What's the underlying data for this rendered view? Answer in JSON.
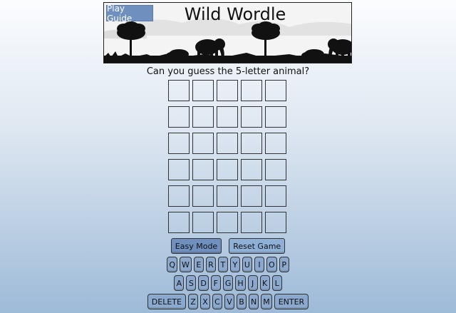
{
  "header": {
    "title": "Wild Wordle",
    "guide_label": "Play Guide"
  },
  "prompt": "Can you guess the 5-letter animal?",
  "board": {
    "rows": 6,
    "cols": 5
  },
  "controls": {
    "easy_label": "Easy Mode",
    "reset_label": "Reset Game"
  },
  "keyboard": {
    "row1": [
      "Q",
      "W",
      "E",
      "R",
      "T",
      "Y",
      "U",
      "I",
      "O",
      "P"
    ],
    "row2": [
      "A",
      "S",
      "D",
      "F",
      "G",
      "H",
      "J",
      "K",
      "L"
    ],
    "row3": [
      "DELETE",
      "Z",
      "X",
      "C",
      "V",
      "B",
      "N",
      "M",
      "ENTER"
    ]
  },
  "colors": {
    "accent": "#6f8fbe",
    "key": "#8ba9cf"
  }
}
